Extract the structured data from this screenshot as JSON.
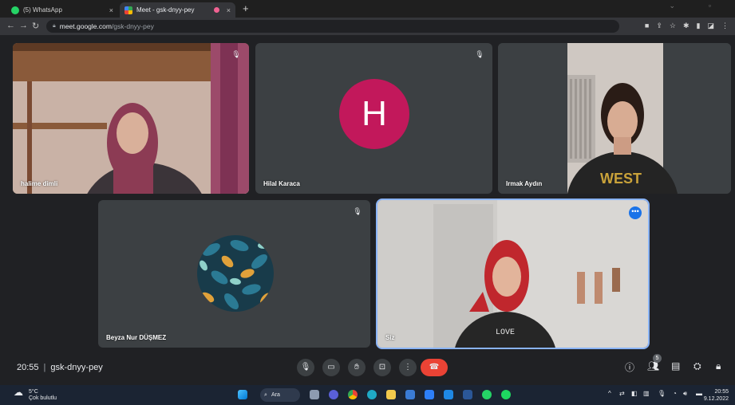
{
  "browser": {
    "tabs": [
      {
        "label": "(5) WhatsApp",
        "close": "×"
      },
      {
        "label": "Meet - gsk-dnyy-pey",
        "close": "×"
      }
    ],
    "new_tab": "+",
    "address": {
      "host": "meet.google.com",
      "path": "/gsk-dnyy-pey"
    }
  },
  "meet": {
    "participants": [
      {
        "name": "halime dimli",
        "muted": true
      },
      {
        "name": "Hilal Karaca",
        "muted": true,
        "avatar_letter": "H",
        "avatar_color": "#c2185b"
      },
      {
        "name": "Irmak Aydın"
      },
      {
        "name": "Beyza Nur DÜŞMEZ",
        "muted": true
      },
      {
        "name": "Siz",
        "self": true
      }
    ],
    "more_options": "•••",
    "time": "20:55",
    "meeting_code": "gsk-dnyy-pey",
    "people_count": "5",
    "accent_color": "#1a73e8",
    "end_call_color": "#ea4335"
  },
  "taskbar": {
    "weather": {
      "temp": "5°C",
      "condition": "Çok bulutlu"
    },
    "search_label": "Ara",
    "clock": {
      "time": "20:55",
      "date": "9.12.2022"
    }
  }
}
